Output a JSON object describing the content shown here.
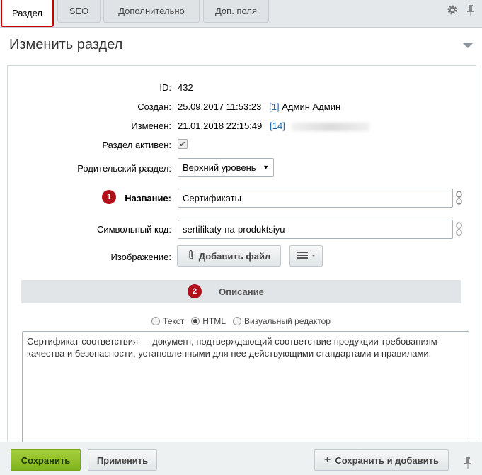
{
  "tabs": [
    {
      "label": "Раздел"
    },
    {
      "label": "SEO"
    },
    {
      "label": "Дополнительно"
    },
    {
      "label": "Доп. поля"
    }
  ],
  "header": {
    "title": "Изменить раздел"
  },
  "fields": {
    "id_label": "ID:",
    "id_value": "432",
    "created_label": "Создан:",
    "created_value": "25.09.2017 11:53:23",
    "created_user_id": "[1]",
    "created_user_name": "Админ Админ",
    "modified_label": "Изменен:",
    "modified_value": "21.01.2018 22:15:49",
    "modified_user_id": "[14]",
    "active_label": "Раздел активен:",
    "active_checked": true,
    "parent_label": "Родительский раздел:",
    "parent_value": "Верхний уровень",
    "name_badge": "1",
    "name_label": "Название:",
    "name_value": "Сертификаты",
    "code_label": "Символьный код:",
    "code_value": "sertifikaty-na-produktsiyu",
    "image_label": "Изображение:",
    "image_button": "Добавить файл"
  },
  "description": {
    "badge": "2",
    "title": "Описание",
    "modes": [
      "Текст",
      "HTML",
      "Визуальный редактор"
    ],
    "selected_mode": "HTML",
    "text_line1": "Сертификат соответствия — документ, подтверждающий соответствие продукции требованиям",
    "text_line2": "качества и безопасности, установленными для нее действующими стандартами и правилами."
  },
  "footer": {
    "save": "Сохранить",
    "apply": "Применить",
    "save_add": "Сохранить и добавить"
  },
  "colors": {
    "accent_red": "#b0101a",
    "save_green": "#8bbd25",
    "link_blue": "#2067b0"
  }
}
